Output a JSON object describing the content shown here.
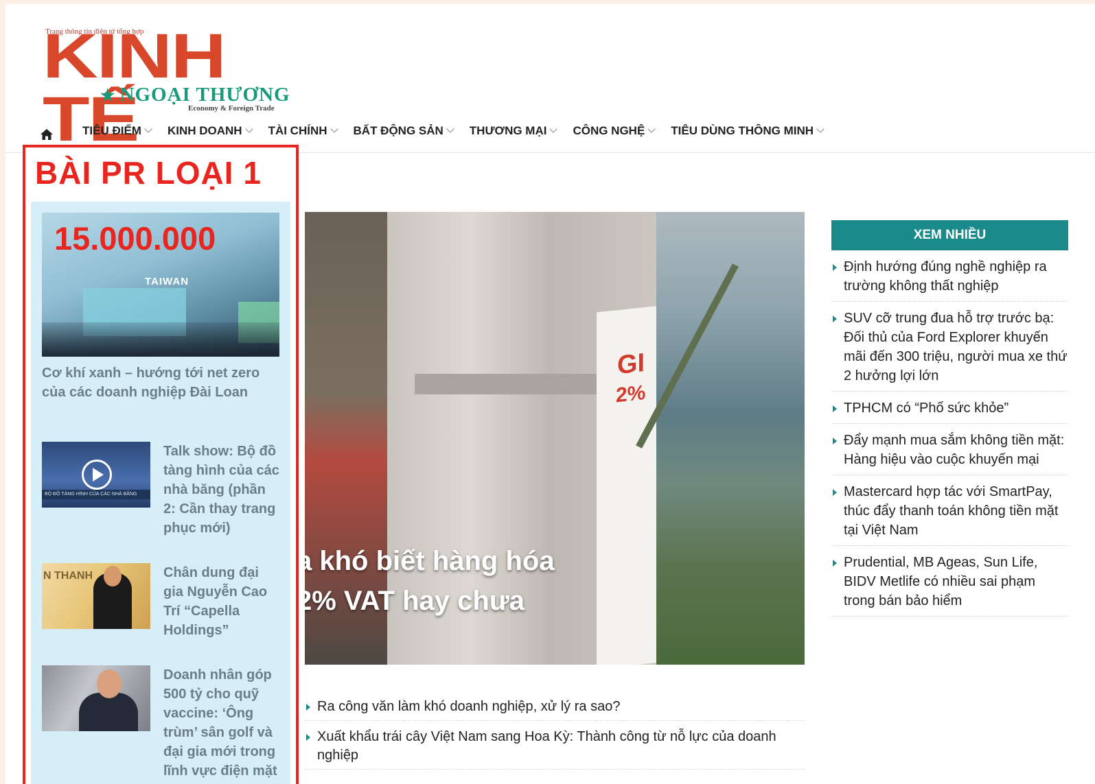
{
  "logo": {
    "tagline": "Trang thông tin điện tử tổng hợp",
    "main": "KINH TẾ",
    "sub": "NGOẠI THƯƠNG",
    "english": "Economy & Foreign Trade",
    "color": "#d9472b",
    "accent": "#1a9a7c"
  },
  "nav": {
    "home_icon": "home-icon",
    "items": [
      {
        "label": "TIÊU ĐIỂM"
      },
      {
        "label": "KINH DOANH"
      },
      {
        "label": "TÀI CHÍNH"
      },
      {
        "label": "BẤT ĐỘNG SẢN"
      },
      {
        "label": "THƯƠNG MẠI"
      },
      {
        "label": "CÔNG NGHỆ"
      },
      {
        "label": "TIÊU DÙNG THÔNG MINH"
      }
    ]
  },
  "pr": {
    "title": "BÀI PR LOẠI 1",
    "price": "15.000.000",
    "hero_image_text": "TAIWAN",
    "hero_caption": "Cơ khí xanh – hướng tới net zero của các doanh nghiệp Đài Loan",
    "items": [
      {
        "title": "Talk show: Bộ đồ tàng hình của các nhà băng (phần 2: Cần thay trang phục mới)",
        "thumb_text": "BỘ ĐỒ TÀNG HÌNH CỦA CÁC NHÀ BĂNG"
      },
      {
        "title": "Chân dung đại gia Nguyễn Cao Trí “Capella Holdings”",
        "thumb_text": "N THANH"
      },
      {
        "title": "Doanh nhân góp 500 tỷ cho quỹ vaccine: ‘Ông trùm’ sân golf và đại gia mới trong lĩnh vực điện mặt"
      }
    ],
    "border_color": "#e8251e",
    "panel_color": "#d6eef8"
  },
  "feature": {
    "headline_line1": "a khó biết hàng hóa",
    "headline_line2": "2% VAT hay chưa",
    "sign_text1": "GI",
    "sign_text2": "2%",
    "list": [
      "Ra công văn làm khó doanh nghiệp, xử lý ra sao?",
      "Xuất khẩu trái cây Việt Nam sang Hoa Kỳ: Thành công từ nỗ lực của doanh nghiệp"
    ]
  },
  "sidebar": {
    "title": "XEM NHIỀU",
    "color": "#1a8a8b",
    "items": [
      "Định hướng đúng nghề nghiệp ra trường không thất nghiệp",
      "SUV cỡ trung đua hỗ trợ trước bạ: Đối thủ của Ford Explorer khuyến mãi đến 300 triệu, người mua xe thứ 2 hưởng lợi lớn",
      "TPHCM có “Phố sức khỏe”",
      "Đẩy mạnh mua sắm không tiền mặt: Hàng hiệu vào cuộc khuyến mại",
      "Mastercard hợp tác với SmartPay, thúc đẩy thanh toán không tiền mặt tại Việt Nam",
      "Prudential, MB Ageas, Sun Life, BIDV Metlife có nhiều sai phạm trong bán bảo hiểm"
    ]
  }
}
